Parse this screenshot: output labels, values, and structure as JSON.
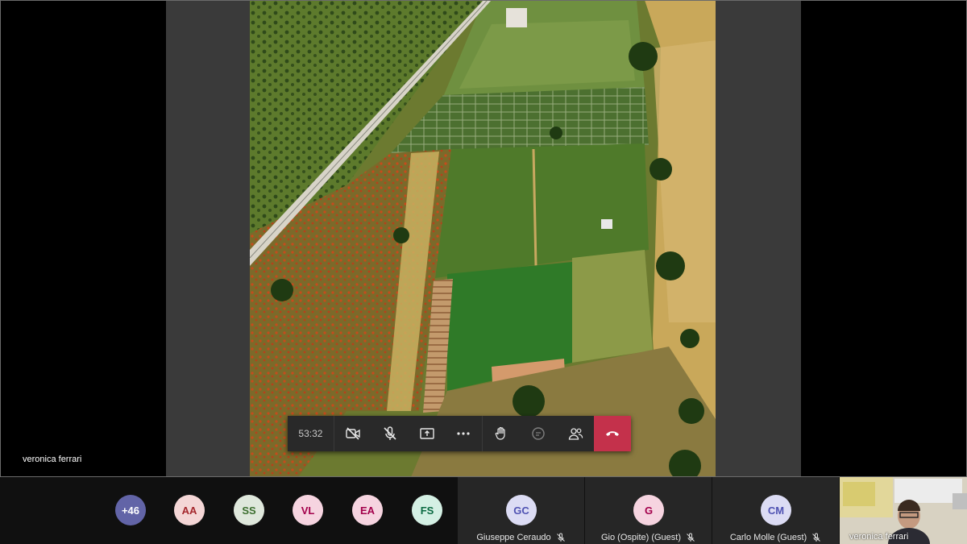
{
  "call": {
    "timer": "53:32",
    "presenter_name": "veronica ferrari",
    "controls": [
      {
        "id": "camera",
        "icon": "camera-off-icon"
      },
      {
        "id": "mic",
        "icon": "mic-off-icon"
      },
      {
        "id": "share",
        "icon": "share-screen-icon"
      },
      {
        "id": "more",
        "icon": "more-icon"
      },
      {
        "id": "raise-hand",
        "icon": "raise-hand-icon"
      },
      {
        "id": "chat",
        "icon": "chat-icon"
      },
      {
        "id": "participants",
        "icon": "participants-icon"
      },
      {
        "id": "hangup",
        "icon": "hang-up-icon"
      }
    ],
    "hangup_color": "#c4314b"
  },
  "participants": {
    "overflow": {
      "label": "+46",
      "color": "#6264a7"
    },
    "avatars": [
      {
        "initials": "AA",
        "bg": "#f4d6d6",
        "fg": "#a4262c"
      },
      {
        "initials": "SS",
        "bg": "#dfe8dc",
        "fg": "#3b6e2e"
      },
      {
        "initials": "VL",
        "bg": "#f6d4e0",
        "fg": "#a3004b"
      },
      {
        "initials": "EA",
        "bg": "#f6d4e0",
        "fg": "#a3004b"
      },
      {
        "initials": "FS",
        "bg": "#d4f0e4",
        "fg": "#0b6a42"
      }
    ],
    "tiles": [
      {
        "initials": "GC",
        "name": "Giuseppe Ceraudo",
        "bg": "#dcdcf4",
        "fg": "#4f52b2"
      },
      {
        "initials": "G",
        "name": "Gio (Ospite) (Guest)",
        "bg": "#f6d4e0",
        "fg": "#a3004b"
      },
      {
        "initials": "CM",
        "name": "Carlo Molle (Guest)",
        "bg": "#dcdcf4",
        "fg": "#4f52b2"
      }
    ],
    "self_view_name": "veronica ferrari"
  }
}
